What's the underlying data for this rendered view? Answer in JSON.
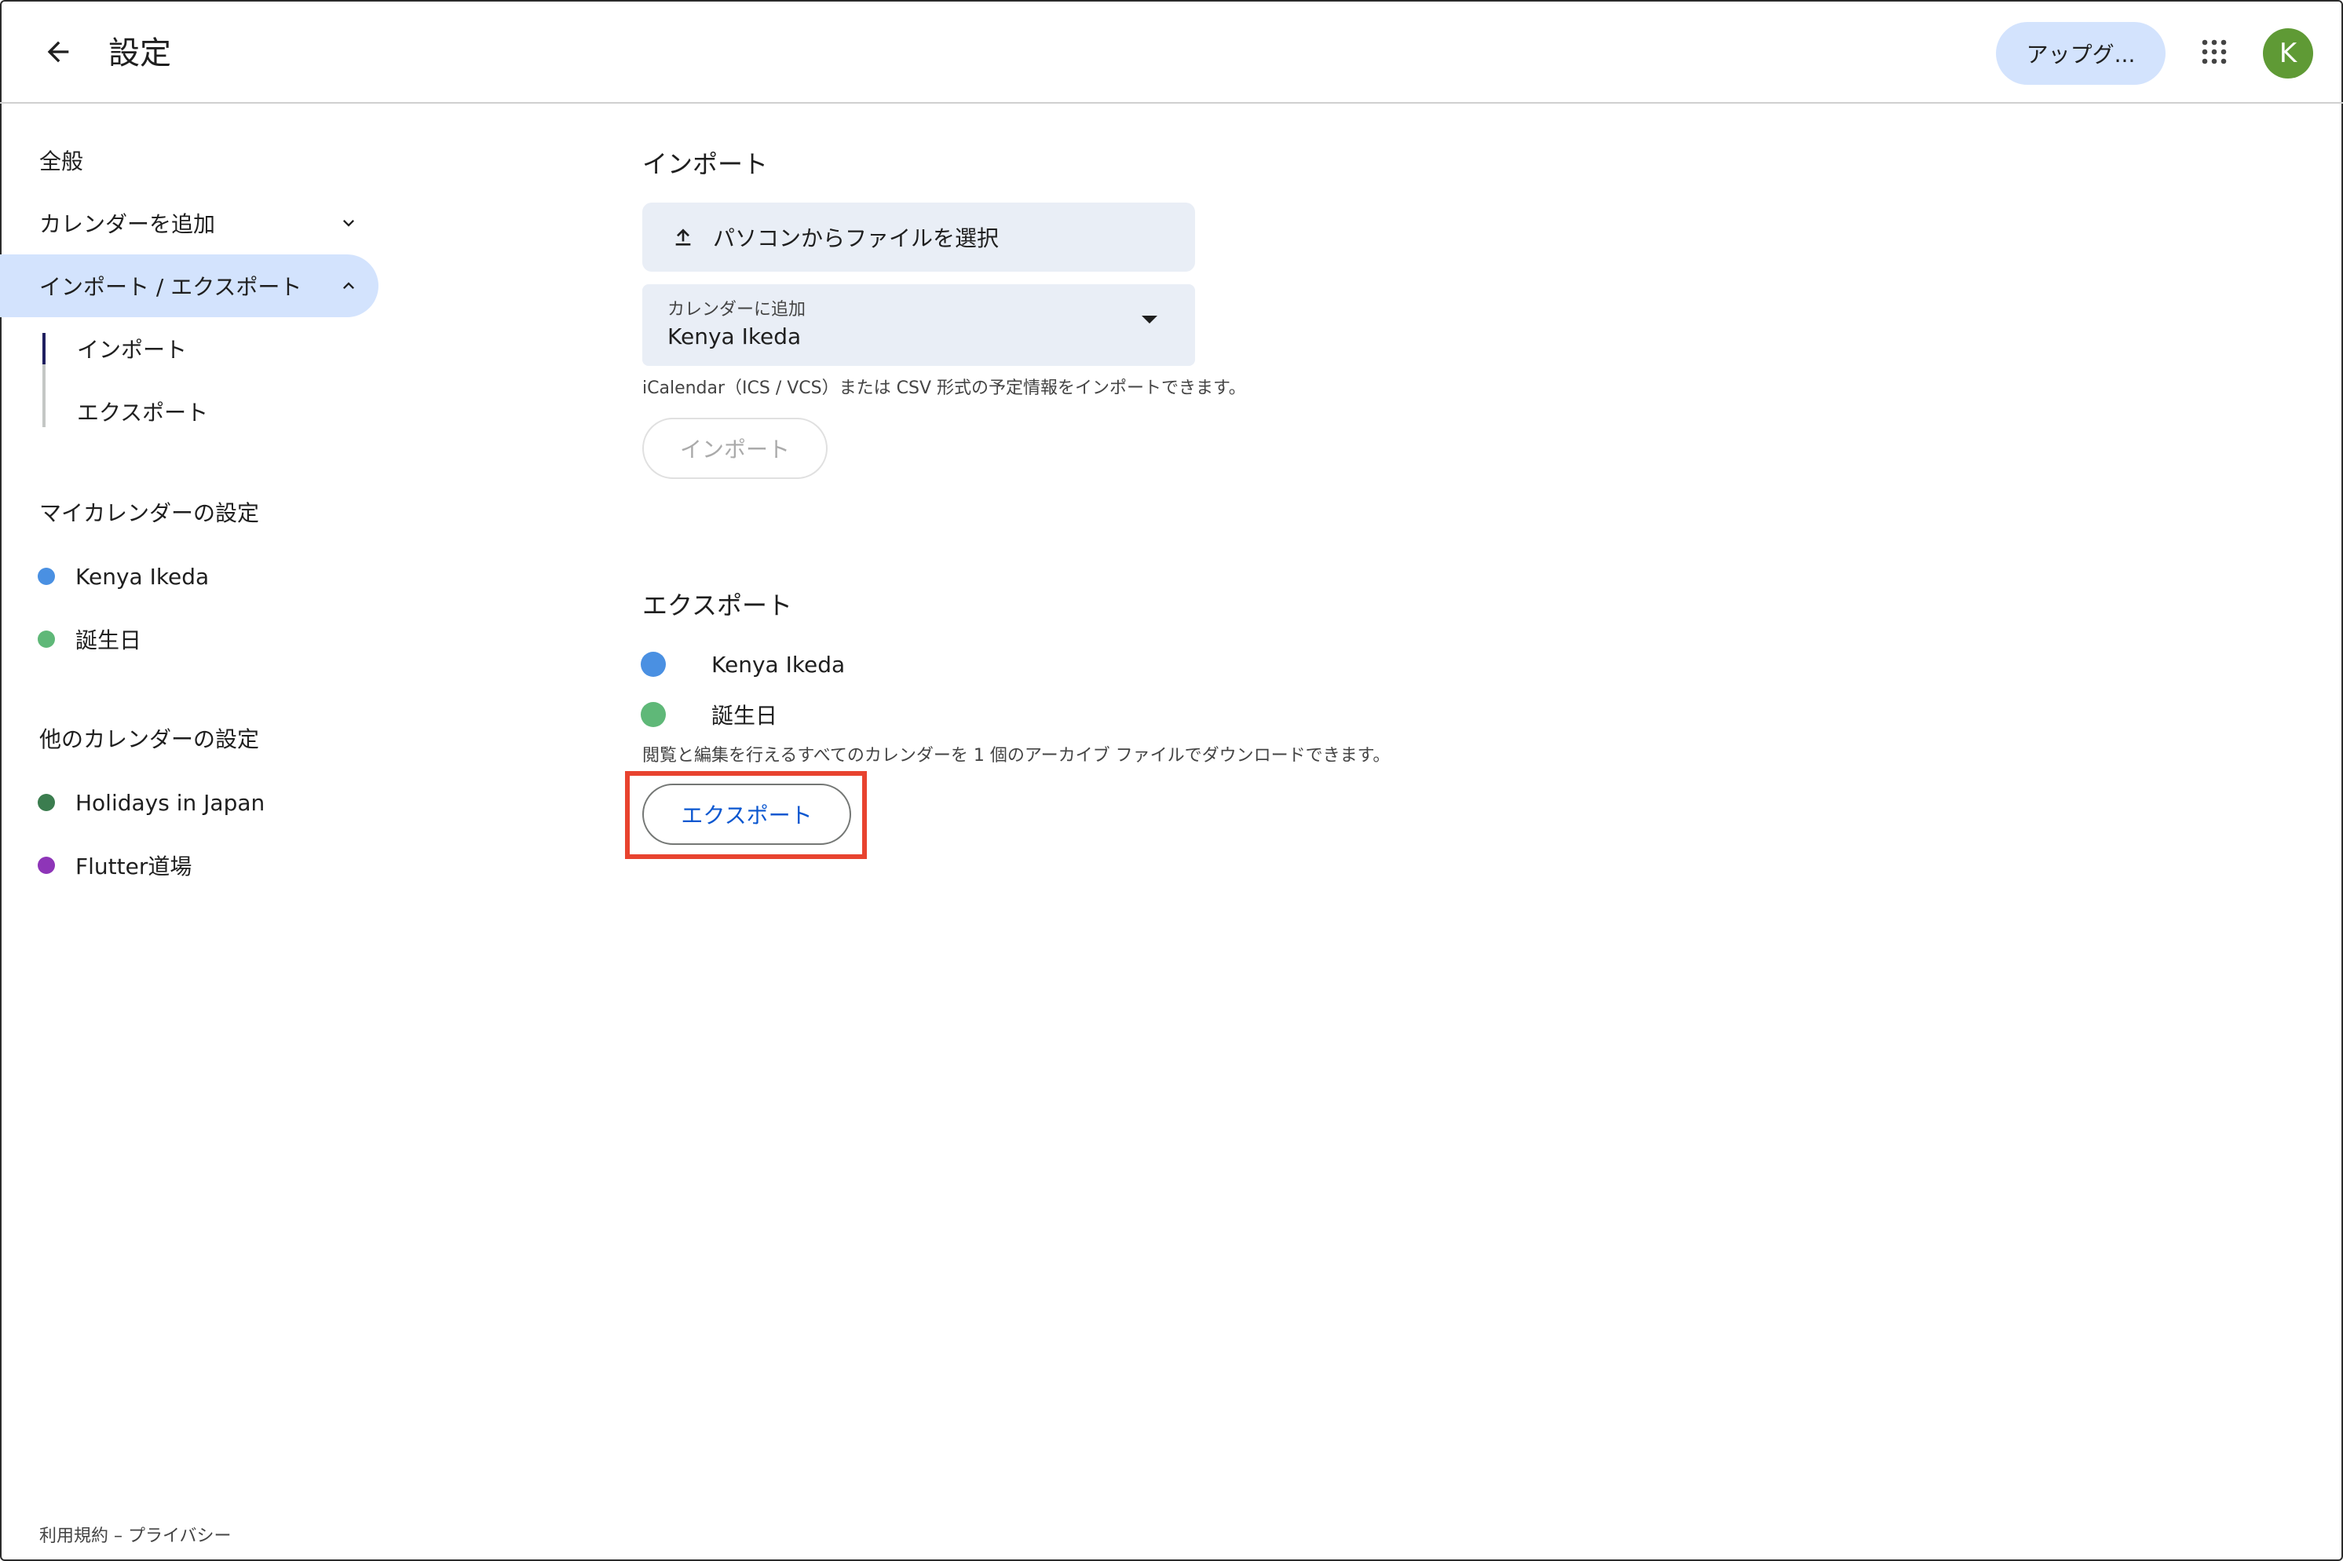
{
  "header": {
    "title": "設定",
    "upgrade_label": "アップグ...",
    "avatar_letter": "K"
  },
  "sidebar": {
    "general": "全般",
    "add_calendar": "カレンダーを追加",
    "import_export": "インポート / エクスポート",
    "sub_import": "インポート",
    "sub_export": "エクスポート",
    "my_calendars_title": "マイカレンダーの設定",
    "my_calendars": [
      {
        "label": "Kenya Ikeda",
        "color": "#4a90e2"
      },
      {
        "label": "誕生日",
        "color": "#5fb878"
      }
    ],
    "other_calendars_title": "他のカレンダーの設定",
    "other_calendars": [
      {
        "label": "Holidays in Japan",
        "color": "#3b7d4f"
      },
      {
        "label": "Flutter道場",
        "color": "#8e35b8"
      }
    ],
    "footer": "利用規約 – プライバシー"
  },
  "import": {
    "title": "インポート",
    "file_button": "パソコンからファイルを選択",
    "select_label": "カレンダーに追加",
    "select_value": "Kenya Ikeda",
    "hint": "iCalendar（ICS / VCS）または CSV 形式の予定情報をインポートできます。",
    "button": "インポート"
  },
  "export": {
    "title": "エクスポート",
    "calendars": [
      {
        "label": "Kenya Ikeda",
        "color": "#4a90e2"
      },
      {
        "label": "誕生日",
        "color": "#5fb878"
      }
    ],
    "hint": "閲覧と編集を行えるすべてのカレンダーを 1 個のアーカイブ ファイルでダウンロードできます。",
    "button": "エクスポート"
  }
}
